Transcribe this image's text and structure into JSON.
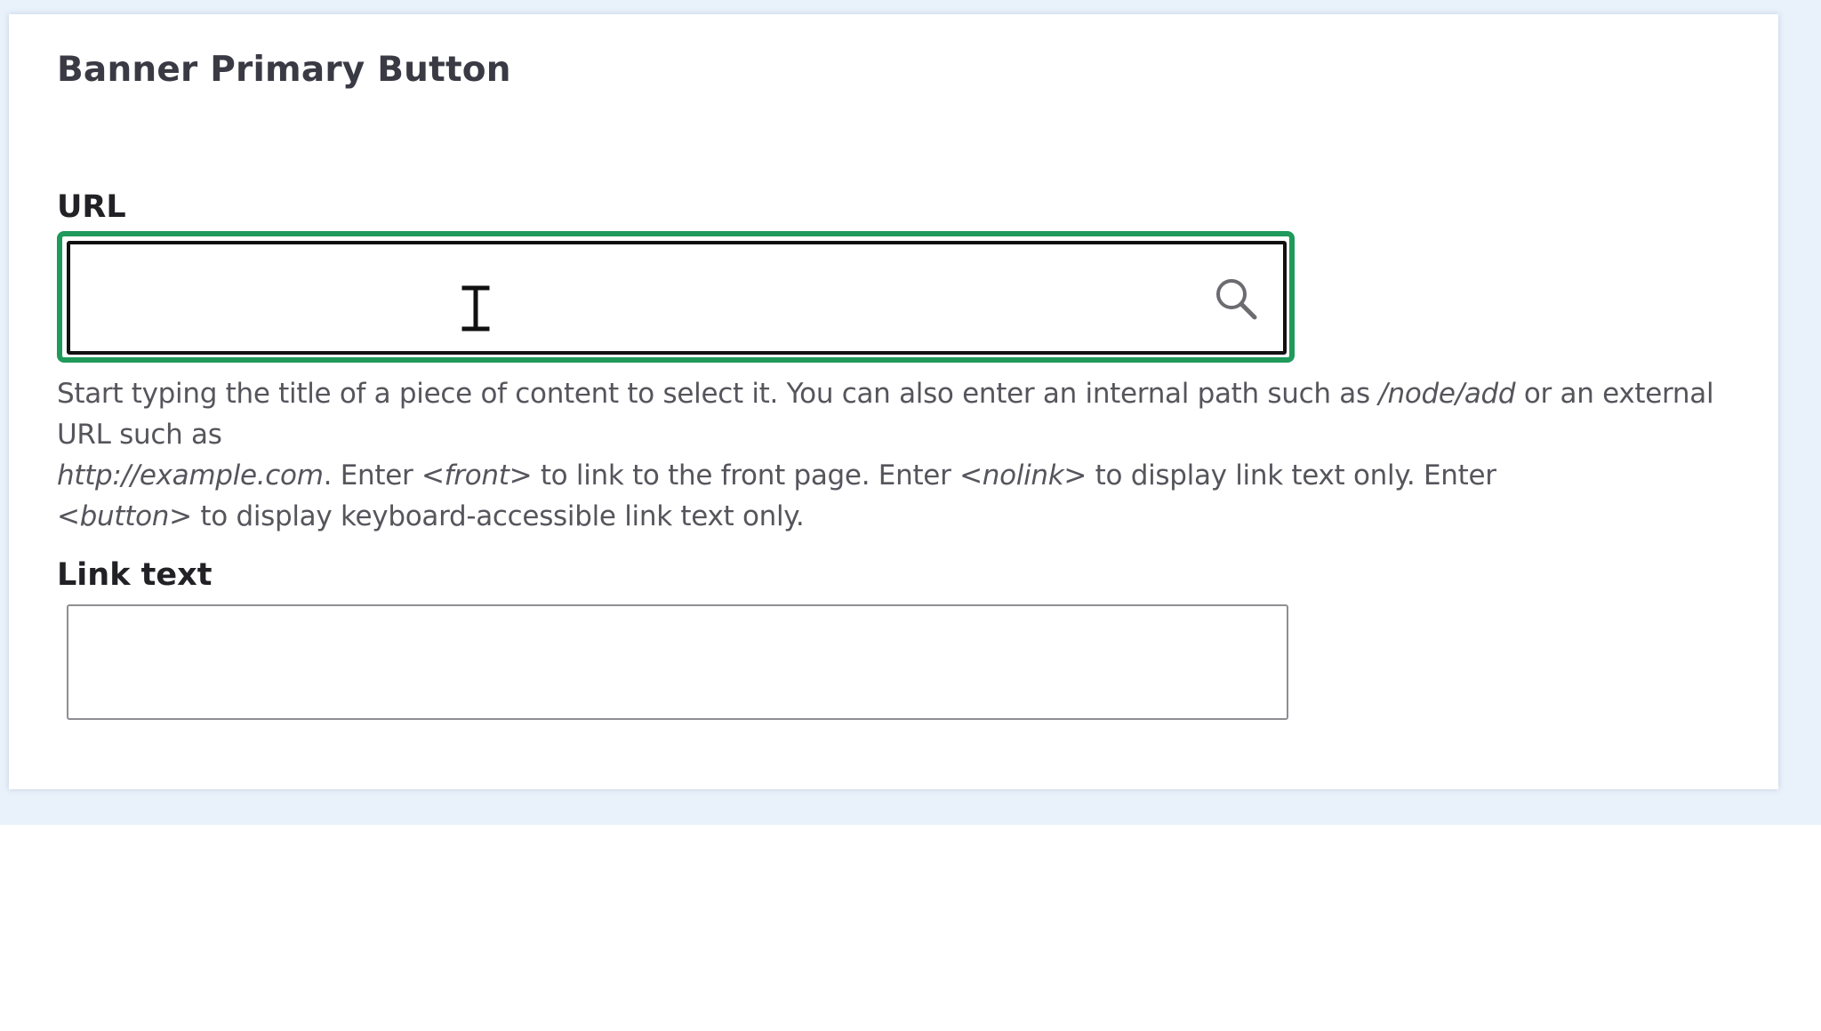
{
  "section": {
    "title": "Banner Primary Button"
  },
  "url_field": {
    "label": "URL",
    "value": "",
    "placeholder": "",
    "icon": "search-icon",
    "focus_color": "#1f9a5a"
  },
  "help": {
    "part1": "Start typing the title of a piece of content to select it. You can also enter an internal path such as ",
    "example_path": "/node/add",
    "part2": " or an external URL such as ",
    "example_url": "http://example.com",
    "part3": ". Enter ",
    "front_token": "<front>",
    "part4": " to link to the front page. Enter ",
    "nolink_token": "<nolink>",
    "part5": " to display link text only. Enter ",
    "button_token": "<button>",
    "part6": " to display keyboard-accessible link text only."
  },
  "link_text_field": {
    "label": "Link text",
    "value": "",
    "placeholder": ""
  }
}
